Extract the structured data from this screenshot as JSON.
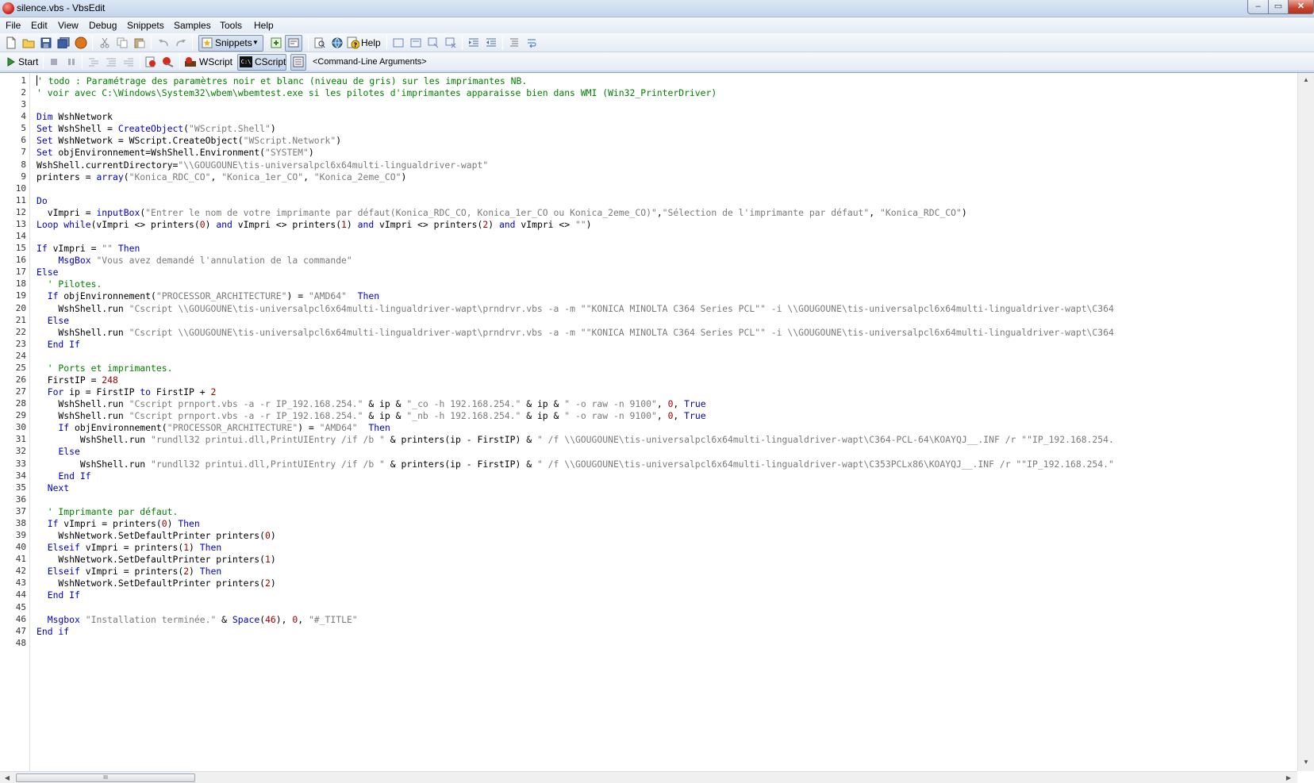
{
  "window": {
    "title": "silence.vbs - VbsEdit",
    "controls": {
      "minimize": "–",
      "maximize": "▭",
      "close": "✕"
    }
  },
  "menu": [
    "File",
    "Edit",
    "View",
    "Debug",
    "Snippets",
    "Samples",
    "Tools",
    "Help"
  ],
  "toolbar1": {
    "snippets_label": "Snippets",
    "help_label": "Help",
    "icons": [
      "new-file-icon",
      "open-folder-icon",
      "save-icon",
      "save-all-icon",
      "record-icon",
      "cut-icon",
      "copy-icon",
      "paste-icon",
      "undo-icon",
      "redo-icon",
      "snippets-icon",
      "insert-icon",
      "toggle-icon",
      "find-icon",
      "object-browser-icon",
      "help-icon",
      "comment-icon",
      "uncomment-icon",
      "bookmark-icon",
      "clear-bookmarks-icon",
      "indent-icon",
      "outdent-icon",
      "format-icon",
      "wrap-icon"
    ]
  },
  "toolbar2": {
    "start_label": "Start",
    "wscript_label": "WScript",
    "cscript_label": "CScript",
    "cmdline_label": "<Command-Line Arguments>",
    "cscript_prefix": "C:\\"
  },
  "editor": {
    "lines": [
      [
        [
          "cm",
          "' todo : Paramétrage des paramètres noir et blanc (niveau de gris) sur les imprimantes NB."
        ]
      ],
      [
        [
          "cm",
          "' voir avec C:\\Windows\\System32\\wbem\\wbemtest.exe si les pilotes d'imprimantes apparaisse bien dans WMI (Win32_PrinterDriver)"
        ]
      ],
      [],
      [
        [
          "kw",
          "Dim"
        ],
        [
          "t",
          " WshNetwork"
        ]
      ],
      [
        [
          "kw",
          "Set"
        ],
        [
          "t",
          " WshShell = "
        ],
        [
          "kw",
          "CreateObject"
        ],
        [
          "t",
          "("
        ],
        [
          "str",
          "\"WScript.Shell\""
        ],
        [
          "t",
          ")"
        ]
      ],
      [
        [
          "kw",
          "Set"
        ],
        [
          "t",
          " WshNetwork = WScript.CreateObject("
        ],
        [
          "str",
          "\"WScript.Network\""
        ],
        [
          "t",
          ")"
        ]
      ],
      [
        [
          "kw",
          "Set"
        ],
        [
          "t",
          " objEnvironnement=WshShell.Environment("
        ],
        [
          "str",
          "\"SYSTEM\""
        ],
        [
          "t",
          ")"
        ]
      ],
      [
        [
          "t",
          "WshShell.currentDirectory="
        ],
        [
          "str",
          "\"\\\\GOUGOUNE\\tis-universalpcl6x64multi-lingualdriver-wapt\""
        ]
      ],
      [
        [
          "t",
          "printers = "
        ],
        [
          "kw",
          "array"
        ],
        [
          "t",
          "("
        ],
        [
          "str",
          "\"Konica_RDC_CO\""
        ],
        [
          "t",
          ", "
        ],
        [
          "str",
          "\"Konica_1er_CO\""
        ],
        [
          "t",
          ", "
        ],
        [
          "str",
          "\"Konica_2eme_CO\""
        ],
        [
          "t",
          ")"
        ]
      ],
      [],
      [
        [
          "kw",
          "Do"
        ]
      ],
      [
        [
          "t",
          "  vImpri = "
        ],
        [
          "kw",
          "inputBox"
        ],
        [
          "t",
          "("
        ],
        [
          "str",
          "\"Entrer le nom de votre imprimante par défaut(Konica_RDC_CO, Konica_1er_CO ou Konica_2eme_CO)\""
        ],
        [
          "t",
          ","
        ],
        [
          "str",
          "\"Sélection de l'imprimante par défaut\""
        ],
        [
          "t",
          ", "
        ],
        [
          "str",
          "\"Konica_RDC_CO\""
        ],
        [
          "t",
          ")"
        ]
      ],
      [
        [
          "kw",
          "Loop while"
        ],
        [
          "t",
          "(vImpri <> printers("
        ],
        [
          "num",
          "0"
        ],
        [
          "t",
          ") "
        ],
        [
          "kw",
          "and"
        ],
        [
          "t",
          " vImpri <> printers("
        ],
        [
          "num",
          "1"
        ],
        [
          "t",
          ") "
        ],
        [
          "kw",
          "and"
        ],
        [
          "t",
          " vImpri <> printers("
        ],
        [
          "num",
          "2"
        ],
        [
          "t",
          ") "
        ],
        [
          "kw",
          "and"
        ],
        [
          "t",
          " vImpri <> "
        ],
        [
          "str",
          "\"\""
        ],
        [
          "t",
          ")"
        ]
      ],
      [],
      [
        [
          "kw",
          "If"
        ],
        [
          "t",
          " vImpri = "
        ],
        [
          "str",
          "\"\""
        ],
        [
          "t",
          " "
        ],
        [
          "kw",
          "Then"
        ]
      ],
      [
        [
          "t",
          "    "
        ],
        [
          "kw",
          "MsgBox"
        ],
        [
          "t",
          " "
        ],
        [
          "str",
          "\"Vous avez demandé l'annulation de la commande\""
        ]
      ],
      [
        [
          "kw",
          "Else"
        ]
      ],
      [
        [
          "t",
          "  "
        ],
        [
          "cm",
          "' Pilotes."
        ]
      ],
      [
        [
          "t",
          "  "
        ],
        [
          "kw",
          "If"
        ],
        [
          "t",
          " objEnvironnement("
        ],
        [
          "str",
          "\"PROCESSOR_ARCHITECTURE\""
        ],
        [
          "t",
          ") = "
        ],
        [
          "str",
          "\"AMD64\""
        ],
        [
          "t",
          "  "
        ],
        [
          "kw",
          "Then"
        ]
      ],
      [
        [
          "t",
          "    WshShell.run "
        ],
        [
          "str",
          "\"Cscript \\\\GOUGOUNE\\tis-universalpcl6x64multi-lingualdriver-wapt\\prndrvr.vbs -a -m \"\"KONICA MINOLTA C364 Series PCL\"\" -i \\\\GOUGOUNE\\tis-universalpcl6x64multi-lingualdriver-wapt\\C364"
        ]
      ],
      [
        [
          "t",
          "  "
        ],
        [
          "kw",
          "Else"
        ]
      ],
      [
        [
          "t",
          "    WshShell.run "
        ],
        [
          "str",
          "\"Cscript \\\\GOUGOUNE\\tis-universalpcl6x64multi-lingualdriver-wapt\\prndrvr.vbs -a -m \"\"KONICA MINOLTA C364 Series PCL\"\" -i \\\\GOUGOUNE\\tis-universalpcl6x64multi-lingualdriver-wapt\\C364"
        ]
      ],
      [
        [
          "t",
          "  "
        ],
        [
          "kw",
          "End If"
        ]
      ],
      [],
      [
        [
          "t",
          "  "
        ],
        [
          "cm",
          "' Ports et imprimantes."
        ]
      ],
      [
        [
          "t",
          "  FirstIP = "
        ],
        [
          "num",
          "248"
        ]
      ],
      [
        [
          "t",
          "  "
        ],
        [
          "kw",
          "For"
        ],
        [
          "t",
          " ip = FirstIP "
        ],
        [
          "kw",
          "to"
        ],
        [
          "t",
          " FirstIP + "
        ],
        [
          "num",
          "2"
        ]
      ],
      [
        [
          "t",
          "    WshShell.run "
        ],
        [
          "str",
          "\"Cscript prnport.vbs -a -r IP_192.168.254.\""
        ],
        [
          "t",
          " & ip & "
        ],
        [
          "str",
          "\"_co -h 192.168.254.\""
        ],
        [
          "t",
          " & ip & "
        ],
        [
          "str",
          "\" -o raw -n 9100\""
        ],
        [
          "t",
          ", "
        ],
        [
          "num",
          "0"
        ],
        [
          "t",
          ", "
        ],
        [
          "kw",
          "True"
        ]
      ],
      [
        [
          "t",
          "    WshShell.run "
        ],
        [
          "str",
          "\"Cscript prnport.vbs -a -r IP_192.168.254.\""
        ],
        [
          "t",
          " & ip & "
        ],
        [
          "str",
          "\"_nb -h 192.168.254.\""
        ],
        [
          "t",
          " & ip & "
        ],
        [
          "str",
          "\" -o raw -n 9100\""
        ],
        [
          "t",
          ", "
        ],
        [
          "num",
          "0"
        ],
        [
          "t",
          ", "
        ],
        [
          "kw",
          "True"
        ]
      ],
      [
        [
          "t",
          "    "
        ],
        [
          "kw",
          "If"
        ],
        [
          "t",
          " objEnvironnement("
        ],
        [
          "str",
          "\"PROCESSOR_ARCHITECTURE\""
        ],
        [
          "t",
          ") = "
        ],
        [
          "str",
          "\"AMD64\""
        ],
        [
          "t",
          "  "
        ],
        [
          "kw",
          "Then"
        ]
      ],
      [
        [
          "t",
          "        WshShell.run "
        ],
        [
          "str",
          "\"rundll32 printui.dll,PrintUIEntry /if /b \""
        ],
        [
          "t",
          " & printers(ip - FirstIP) & "
        ],
        [
          "str",
          "\" /f \\\\GOUGOUNE\\tis-universalpcl6x64multi-lingualdriver-wapt\\C364-PCL-64\\KOAYQJ__.INF /r \"\"IP_192.168.254."
        ]
      ],
      [
        [
          "t",
          "    "
        ],
        [
          "kw",
          "Else"
        ]
      ],
      [
        [
          "t",
          "        WshShell.run "
        ],
        [
          "str",
          "\"rundll32 printui.dll,PrintUIEntry /if /b \""
        ],
        [
          "t",
          " & printers(ip - FirstIP) & "
        ],
        [
          "str",
          "\" /f \\\\GOUGOUNE\\tis-universalpcl6x64multi-lingualdriver-wapt\\C353PCLx86\\KOAYQJ__.INF /r \"\"IP_192.168.254.\""
        ]
      ],
      [
        [
          "t",
          "    "
        ],
        [
          "kw",
          "End If"
        ]
      ],
      [
        [
          "t",
          "  "
        ],
        [
          "kw",
          "Next"
        ]
      ],
      [],
      [
        [
          "t",
          "  "
        ],
        [
          "cm",
          "' Imprimante par défaut."
        ]
      ],
      [
        [
          "t",
          "  "
        ],
        [
          "kw",
          "If"
        ],
        [
          "t",
          " vImpri = printers("
        ],
        [
          "num",
          "0"
        ],
        [
          "t",
          ") "
        ],
        [
          "kw",
          "Then"
        ]
      ],
      [
        [
          "t",
          "    WshNetwork.SetDefaultPrinter printers("
        ],
        [
          "num",
          "0"
        ],
        [
          "t",
          ")"
        ]
      ],
      [
        [
          "t",
          "  "
        ],
        [
          "kw",
          "Elseif"
        ],
        [
          "t",
          " vImpri = printers("
        ],
        [
          "num",
          "1"
        ],
        [
          "t",
          ") "
        ],
        [
          "kw",
          "Then"
        ]
      ],
      [
        [
          "t",
          "    WshNetwork.SetDefaultPrinter printers("
        ],
        [
          "num",
          "1"
        ],
        [
          "t",
          ")"
        ]
      ],
      [
        [
          "t",
          "  "
        ],
        [
          "kw",
          "Elseif"
        ],
        [
          "t",
          " vImpri = printers("
        ],
        [
          "num",
          "2"
        ],
        [
          "t",
          ") "
        ],
        [
          "kw",
          "Then"
        ]
      ],
      [
        [
          "t",
          "    WshNetwork.SetDefaultPrinter printers("
        ],
        [
          "num",
          "2"
        ],
        [
          "t",
          ")"
        ]
      ],
      [
        [
          "t",
          "  "
        ],
        [
          "kw",
          "End If"
        ]
      ],
      [],
      [
        [
          "t",
          "  "
        ],
        [
          "kw",
          "Msgbox"
        ],
        [
          "t",
          " "
        ],
        [
          "str",
          "\"Installation terminée.\""
        ],
        [
          "t",
          " & "
        ],
        [
          "kw",
          "Space"
        ],
        [
          "t",
          "("
        ],
        [
          "num",
          "46"
        ],
        [
          "t",
          "), "
        ],
        [
          "num",
          "0"
        ],
        [
          "t",
          ", "
        ],
        [
          "str",
          "\"#_TITLE\""
        ]
      ],
      [
        [
          "kw",
          "End if"
        ]
      ],
      []
    ]
  },
  "scrollbars": {
    "up": "▲",
    "down": "▼",
    "left": "◀",
    "right": "▶",
    "grip": "III"
  },
  "colors": {
    "keyword": "#0000c8",
    "string": "#7a7a7a",
    "comment": "#008000",
    "number": "#a00000"
  }
}
